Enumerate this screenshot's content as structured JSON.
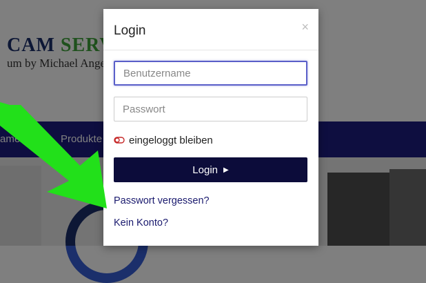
{
  "background": {
    "brand_line1_a": "CAM ",
    "brand_line1_b": "SERVIC",
    "brand_line2": "um by Michael Ange",
    "nav_item_1": "ame",
    "nav_item_2": "Produkte",
    "colors": {
      "navbar": "#1d1d80",
      "brand_blue": "#1b2f6b",
      "brand_green": "#3fa33a"
    }
  },
  "modal": {
    "title": "Login",
    "close_icon": "close-icon",
    "username_placeholder": "Benutzername",
    "password_placeholder": "Passwort",
    "remember_label": "eingeloggt bleiben",
    "login_button": "Login",
    "forgot_link": "Passwort vergessen?",
    "signup_link": "Kein Konto?",
    "colors": {
      "button_bg": "#0c0c3a",
      "link": "#1a1a6e",
      "focus_border": "#5a5fc9",
      "toggle": "#c62828"
    }
  },
  "annotation": {
    "arrow_color": "#22e01a",
    "arrow_icon": "arrow-pointer-icon"
  }
}
